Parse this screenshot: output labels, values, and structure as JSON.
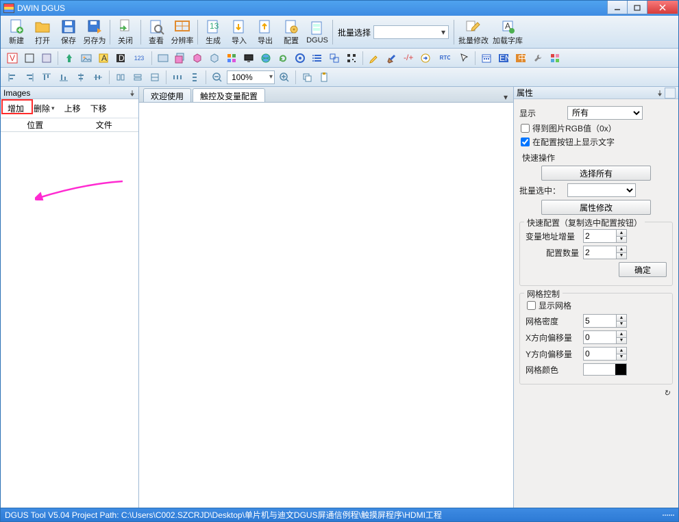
{
  "window": {
    "title": "DWIN DGUS"
  },
  "toolbar_big": [
    {
      "name": "new-button",
      "label": "新建",
      "icon": "doc-new"
    },
    {
      "name": "open-button",
      "label": "打开",
      "icon": "folder-open"
    },
    {
      "name": "save-button",
      "label": "保存",
      "icon": "disk"
    },
    {
      "name": "saveas-button",
      "label": "另存为",
      "icon": "disk-as"
    },
    {
      "name": "close-button",
      "label": "关闭",
      "icon": "doc-close"
    },
    {
      "name": "view-button",
      "label": "查看",
      "icon": "view"
    },
    {
      "name": "resolution-button",
      "label": "分辨率",
      "icon": "resolution"
    },
    {
      "name": "generate-button",
      "label": "生成",
      "icon": "generate"
    },
    {
      "name": "import-button",
      "label": "导入",
      "icon": "import"
    },
    {
      "name": "export-button",
      "label": "导出",
      "icon": "export"
    },
    {
      "name": "config-button",
      "label": "配置",
      "icon": "config"
    },
    {
      "name": "dgus-button",
      "label": "DGUS",
      "icon": "dgus"
    }
  ],
  "batch_select_label": "批量选择",
  "toolbar_big_right": [
    {
      "name": "batch-edit-button",
      "label": "批量修改",
      "icon": "batch-edit"
    },
    {
      "name": "load-font-button",
      "label": "加载字库",
      "icon": "load-font"
    }
  ],
  "zoom_value": "100%",
  "images_panel": {
    "title": "Images",
    "add": "增加",
    "delete": "删除",
    "moveup": "上移",
    "movedown": "下移",
    "col_pos": "位置",
    "col_file": "文件"
  },
  "center_tabs": {
    "welcome": "欢迎使用",
    "touchcfg": "触控及变量配置"
  },
  "props": {
    "title": "属性",
    "display": "显示",
    "display_value": "所有",
    "rgb_check": "得到图片RGB值（0x）",
    "showtext_check": "在配置按钮上显示文字",
    "quickop": "快速操作",
    "select_all": "选择所有",
    "batch_sel": "批量选中：",
    "edit_props": "属性修改",
    "quick_cfg": "快速配置（复制选中配置按钮）",
    "var_addr_inc": "变量地址增量",
    "var_addr_inc_val": "2",
    "cfg_count": "配置数量",
    "cfg_count_val": "2",
    "ok": "确定",
    "grid_ctrl": "网格控制",
    "show_grid": "显示网格",
    "grid_density": "网格密度",
    "grid_density_val": "5",
    "x_offset": "X方向偏移量",
    "x_offset_val": "0",
    "y_offset": "Y方向偏移量",
    "y_offset_val": "0",
    "grid_color": "网格颜色",
    "refresh": "↻"
  },
  "statusbar": "DGUS Tool V5.04  Project Path: C:\\Users\\C002.SZCRJD\\Desktop\\单片机与迪文DGUS屏通信例程\\触摸屏程序\\HDMI工程"
}
